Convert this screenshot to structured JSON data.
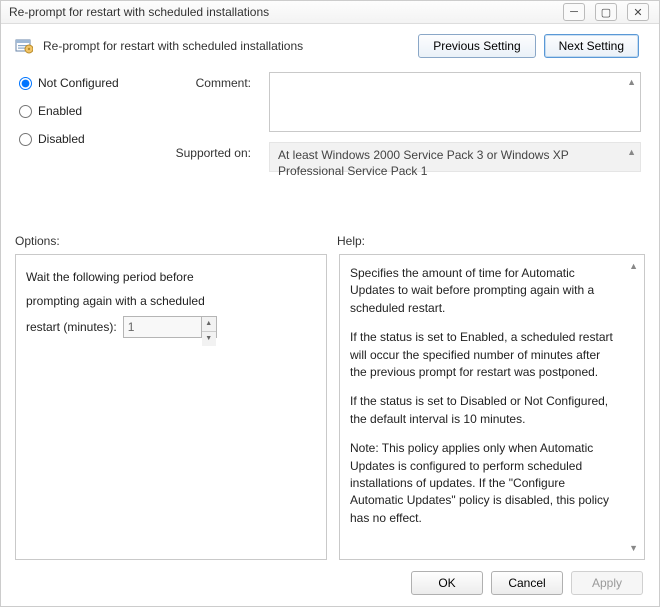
{
  "window": {
    "title": "Re-prompt for restart with scheduled installations"
  },
  "header": {
    "title": "Re-prompt for restart with scheduled installations",
    "prev": "Previous Setting",
    "next": "Next Setting"
  },
  "config": {
    "radios": {
      "not_configured": "Not Configured",
      "enabled": "Enabled",
      "disabled": "Disabled",
      "selected": "not_configured"
    },
    "labels": {
      "comment": "Comment:",
      "supported": "Supported on:"
    },
    "comment": "",
    "supported": "At least Windows 2000 Service Pack 3 or Windows XP Professional Service Pack 1"
  },
  "sections": {
    "options": "Options:",
    "help": "Help:"
  },
  "options": {
    "line1": "Wait the following period before",
    "line2": "prompting again with a scheduled",
    "line3_label": "restart (minutes):",
    "value": "1"
  },
  "help": {
    "p1": "Specifies the amount of time for Automatic Updates to wait before prompting again with a scheduled restart.",
    "p2": "If the status is set to Enabled, a scheduled restart will occur the specified number of minutes after the previous prompt for restart was postponed.",
    "p3": "If the status is set to Disabled or Not Configured, the default interval is 10 minutes.",
    "p4": "Note: This policy applies only when Automatic Updates is configured to perform scheduled installations of updates. If the \"Configure Automatic Updates\" policy is disabled, this policy has no effect."
  },
  "footer": {
    "ok": "OK",
    "cancel": "Cancel",
    "apply": "Apply"
  }
}
